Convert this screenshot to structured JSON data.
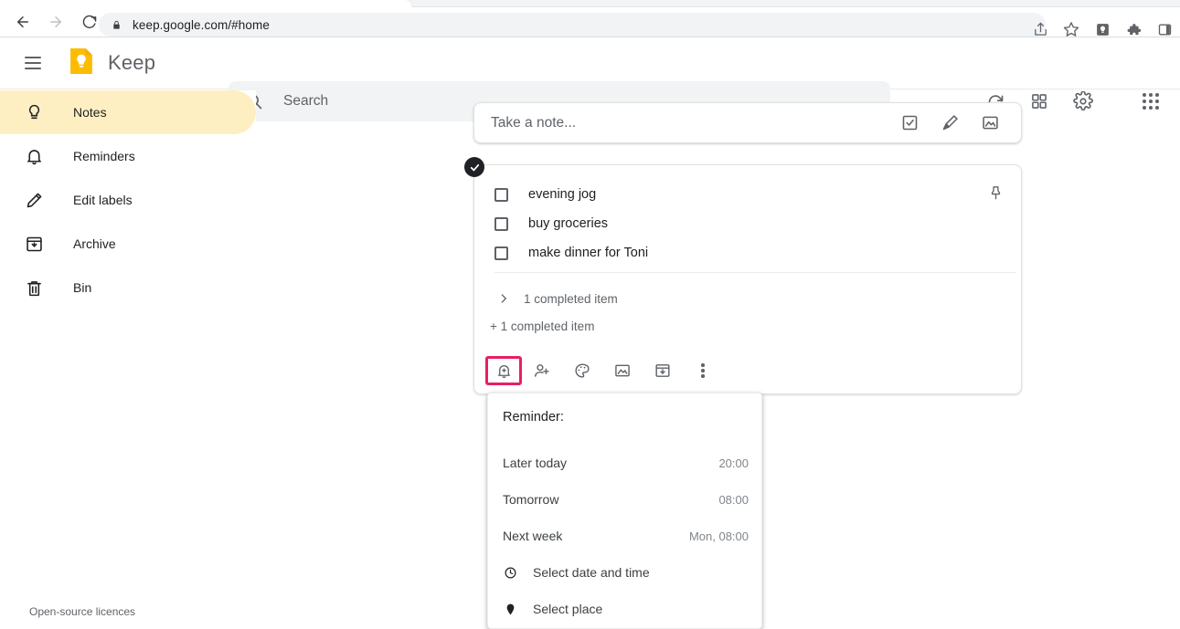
{
  "browser": {
    "back_icon": "back-arrow-icon",
    "forward_icon": "forward-arrow-icon",
    "reload_icon": "reload-icon",
    "lock_icon": "lock-icon",
    "url": "keep.google.com/#home",
    "share_icon": "share-icon",
    "bookmark_icon": "star-icon",
    "keep_extension_icon": "keep-extension-icon",
    "extensions_icon": "puzzle-piece-icon",
    "sidepanel_icon": "side-panel-icon"
  },
  "header": {
    "menu_icon": "hamburger-menu-icon",
    "logo_icon": "keep-logo-icon",
    "app_title": "Keep",
    "refresh_icon": "refresh-icon",
    "view_toggle_icon": "grid-view-icon",
    "settings_icon": "settings-gear-icon",
    "apps_icon": "google-apps-icon"
  },
  "search": {
    "icon": "search-icon",
    "placeholder": "Search",
    "value": ""
  },
  "sidebar": {
    "items": [
      {
        "label": "Notes",
        "icon": "lightbulb-icon",
        "active": true
      },
      {
        "label": "Reminders",
        "icon": "bell-icon",
        "active": false
      },
      {
        "label": "Edit labels",
        "icon": "pencil-icon",
        "active": false
      },
      {
        "label": "Archive",
        "icon": "archive-icon",
        "active": false
      },
      {
        "label": "Bin",
        "icon": "trash-icon",
        "active": false
      }
    ],
    "footer_link": "Open-source licences"
  },
  "take_note": {
    "placeholder": "Take a note...",
    "value": "",
    "actions": [
      {
        "icon": "new-list-icon"
      },
      {
        "icon": "new-drawing-icon"
      },
      {
        "icon": "new-image-icon"
      }
    ]
  },
  "note_card": {
    "selected_badge_icon": "check-circle-icon",
    "pin_icon": "pin-icon",
    "items": [
      {
        "text": "evening jog",
        "checked": false
      },
      {
        "text": "buy groceries",
        "checked": false
      },
      {
        "text": "make dinner for Toni",
        "checked": false
      }
    ],
    "completed_toggle": {
      "chevron_icon": "chevron-right-icon",
      "label": "1 completed item"
    },
    "completed_add_label": "+ 1 completed item",
    "toolbar": [
      {
        "icon": "reminder-bell-icon",
        "name": "remind-me-button",
        "highlighted": true
      },
      {
        "icon": "person-add-icon",
        "name": "collaborator-button",
        "highlighted": false
      },
      {
        "icon": "palette-icon",
        "name": "background-options-button",
        "highlighted": false
      },
      {
        "icon": "image-icon",
        "name": "add-image-button",
        "highlighted": false
      },
      {
        "icon": "archive-icon",
        "name": "archive-button",
        "highlighted": false
      },
      {
        "icon": "more-vert-icon",
        "name": "more-options-button",
        "highlighted": false
      }
    ],
    "highlight_color": "#e91e63"
  },
  "reminder_menu": {
    "title": "Reminder:",
    "presets": [
      {
        "label": "Later today",
        "time": "20:00"
      },
      {
        "label": "Tomorrow",
        "time": "08:00"
      },
      {
        "label": "Next week",
        "time": "Mon, 08:00"
      }
    ],
    "actions": [
      {
        "label": "Select date and time",
        "icon": "clock-icon"
      },
      {
        "label": "Select place",
        "icon": "location-pin-icon"
      }
    ]
  },
  "colors": {
    "accent_yellow": "#feefc3",
    "logo_yellow": "#fbbc04",
    "highlight_pink": "#e91e63",
    "text_primary": "#202124",
    "text_secondary": "#5f6368"
  }
}
